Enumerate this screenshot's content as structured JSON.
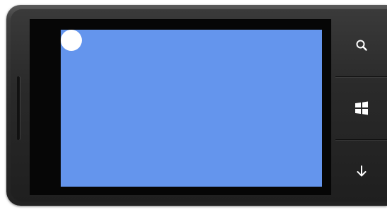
{
  "device": {
    "type": "windows-phone-emulator",
    "hardware_buttons": [
      {
        "name": "search",
        "icon": "search-icon"
      },
      {
        "name": "start",
        "icon": "windows-logo-icon"
      },
      {
        "name": "back",
        "icon": "back-arrow-icon"
      }
    ]
  },
  "app": {
    "background_color": "#6495ED",
    "ball_color": "#FFFFFF"
  }
}
